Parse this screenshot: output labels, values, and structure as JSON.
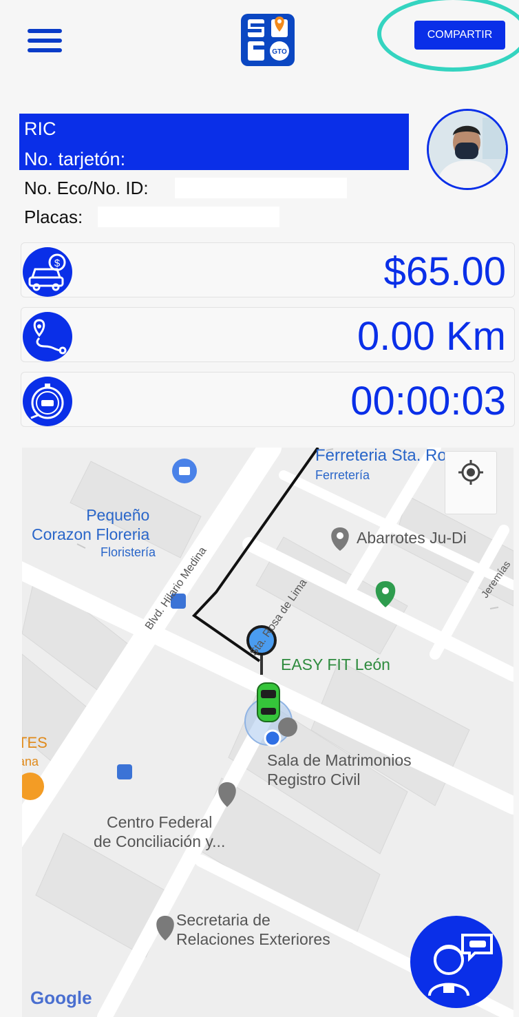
{
  "header": {
    "menu_icon": "hamburger-menu-icon",
    "logo_text": "SIGO GTO",
    "share_label": "COMPARTIR",
    "accent": "#0a2fe8",
    "highlight": "#34d4c0"
  },
  "driver": {
    "name": "RIC",
    "card_label": "No. tarjetón:",
    "eco_label": "No. Eco/No. ID:",
    "plates_label": "Placas:"
  },
  "stats": {
    "fare": "$65.00",
    "distance": "0.00 Km",
    "time": "00:00:03",
    "fare_icon": "taxi-fare-icon",
    "distance_icon": "route-icon",
    "time_icon": "stopwatch-icon"
  },
  "map": {
    "places": {
      "ferreteria": "Ferreteria Sta. Rosa",
      "ferreteria_type": "Ferretería",
      "floreria": "Pequeño\nCorazon Floreria",
      "floreria_type": "Floristería",
      "abarrotes": "Abarrotes Ju-Di",
      "easyfit": "EASY FIT León",
      "sala": "Sala de Matrimonios\nRegistro Civil",
      "centro": "Centro Federal\nde Conciliación y...",
      "secretaria": "Secretaria de\nRelaciones Exteriores",
      "tes": "TES",
      "ana": "ana"
    },
    "streets": {
      "blvd": "Blvd. Hilario Medina",
      "sta_rosa": "Sta. Rosa de Lima",
      "jeremias": "Jeremías"
    },
    "attribution": "Google",
    "locate_icon": "my-location-icon",
    "support_icon": "support-chat-icon"
  }
}
